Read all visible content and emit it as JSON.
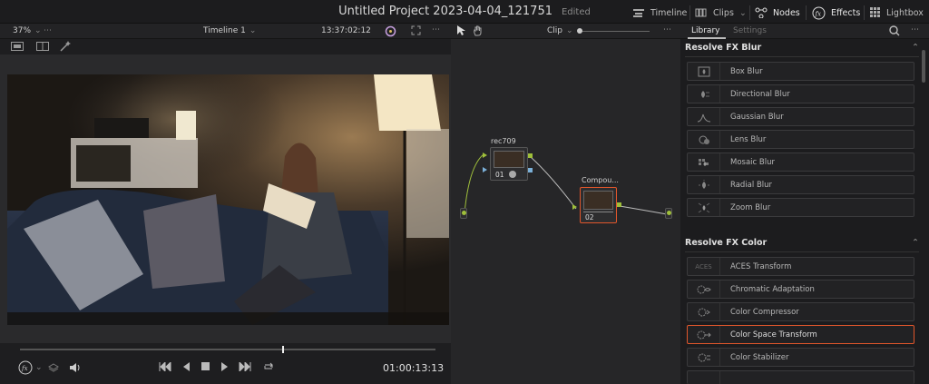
{
  "project": {
    "title": "Untitled Project 2023-04-04_121751",
    "status": "Edited"
  },
  "top_nav": {
    "timeline": "Timeline",
    "clips": "Clips",
    "nodes": "Nodes",
    "effects": "Effects",
    "lightbox": "Lightbox"
  },
  "viewer": {
    "zoom": "37%",
    "timeline_name": "Timeline 1",
    "timecode_top": "13:37:02:12",
    "timecode_bottom": "01:00:13:13",
    "playhead_fraction": 0.63
  },
  "node_editor": {
    "mode": "Clip",
    "node1": {
      "label": "rec709",
      "number": "01"
    },
    "node2": {
      "label": "Compou...",
      "number": "02"
    }
  },
  "right_panel": {
    "tabs": {
      "library": "Library",
      "settings": "Settings"
    },
    "sections": [
      {
        "title": "Resolve FX Blur",
        "items": [
          "Box Blur",
          "Directional Blur",
          "Gaussian Blur",
          "Lens Blur",
          "Mosaic Blur",
          "Radial Blur",
          "Zoom Blur"
        ]
      },
      {
        "title": "Resolve FX Color",
        "items": [
          "ACES Transform",
          "Chromatic Adaptation",
          "Color Compressor",
          "Color Space Transform",
          "Color Stabilizer"
        ]
      }
    ],
    "aces_icon_text": "ACES",
    "selected_item": "Color Space Transform"
  },
  "colors": {
    "accent": "#e0562b",
    "node_link": "#9fbf3b",
    "node_input": "#7bb0d8"
  }
}
